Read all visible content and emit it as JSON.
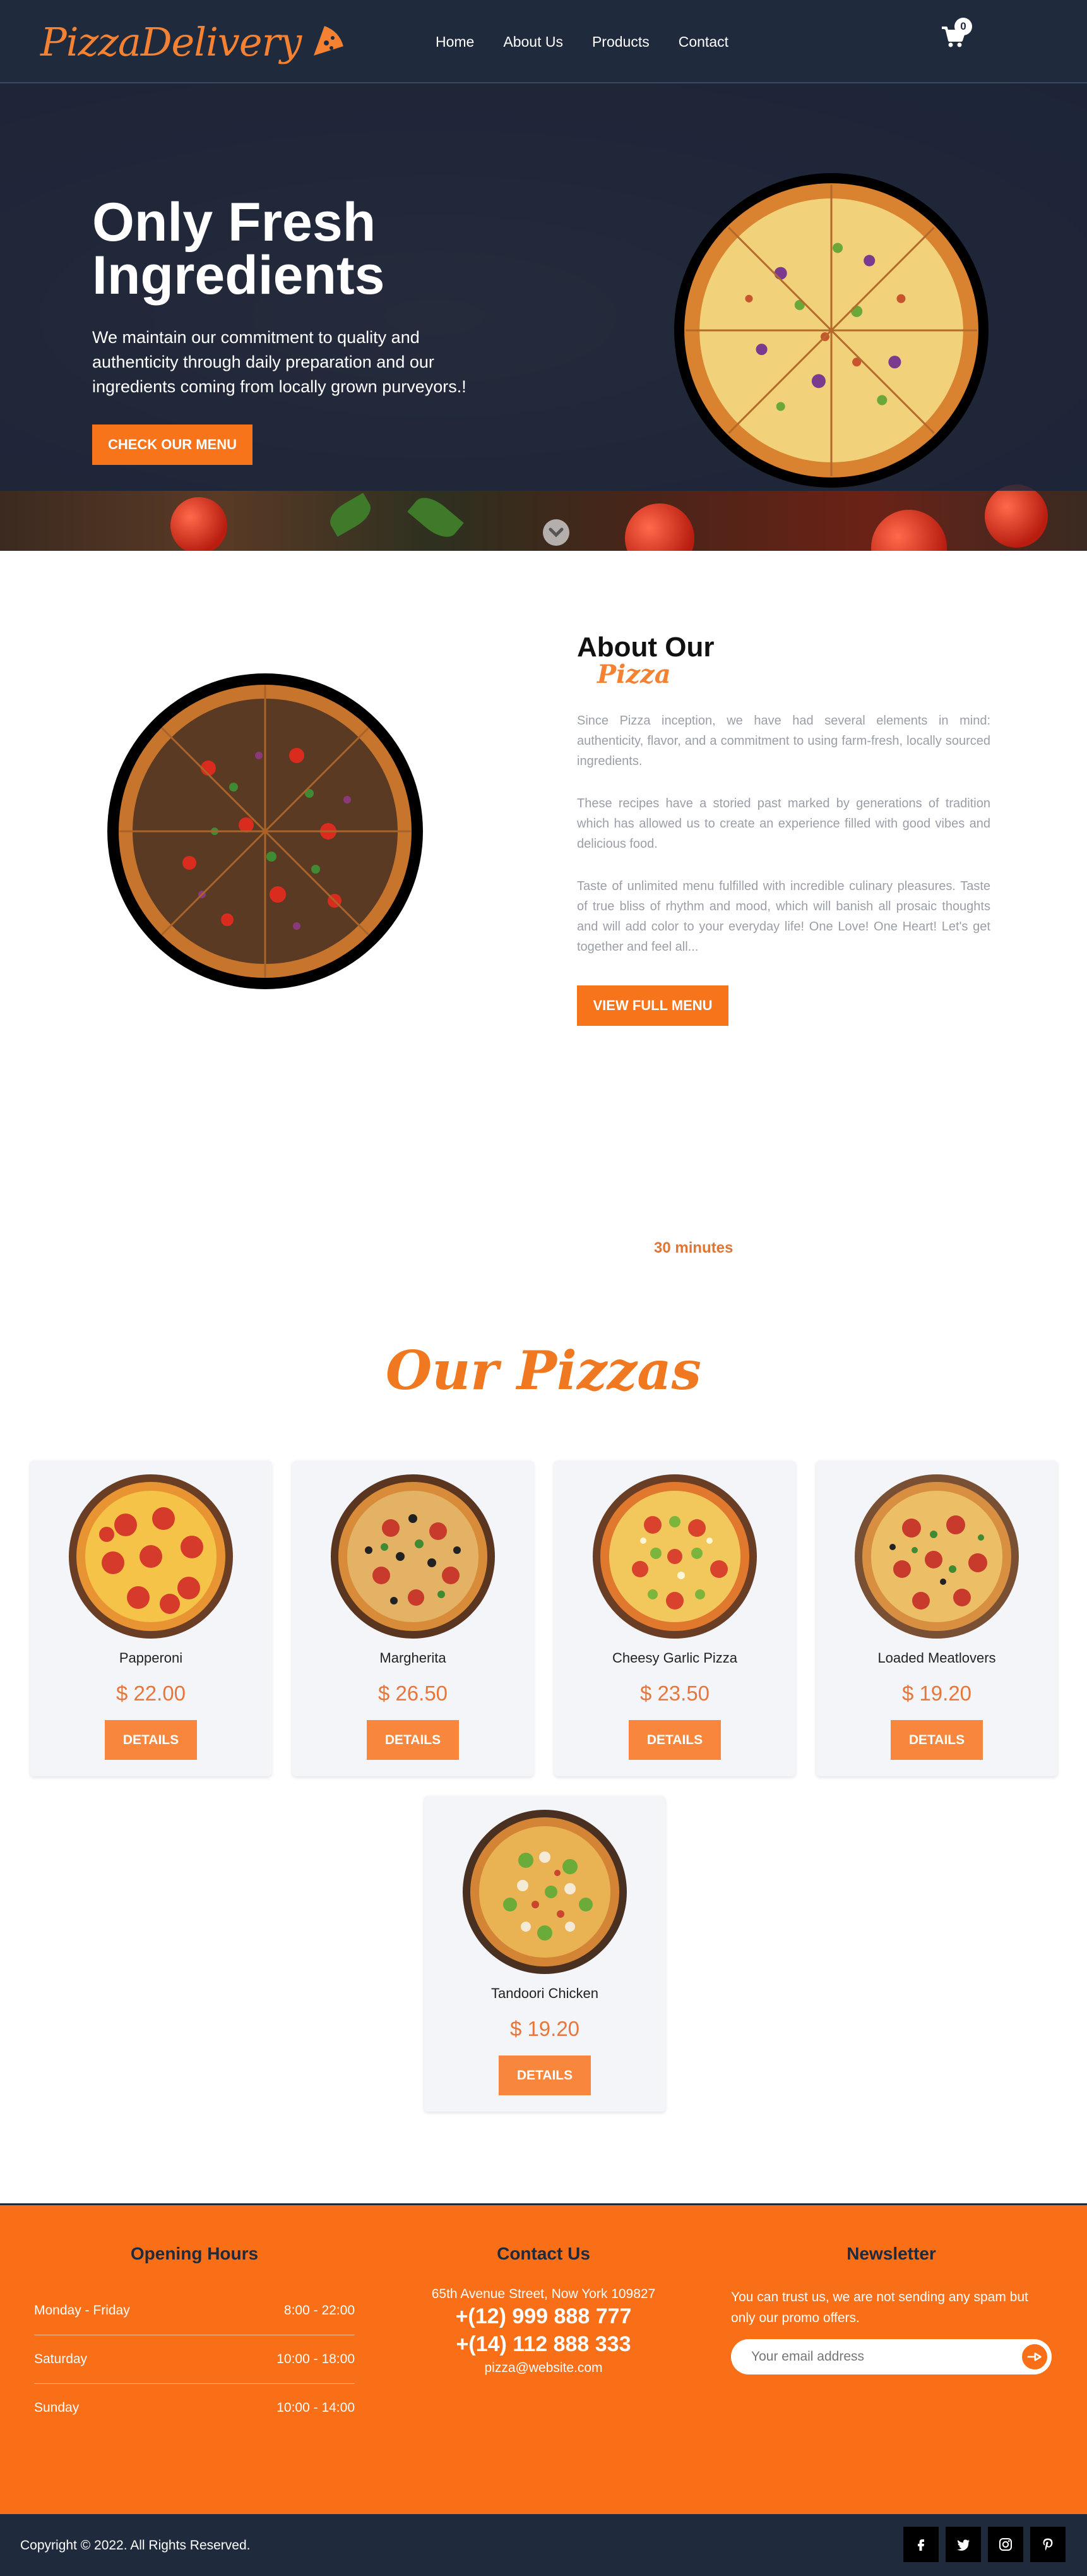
{
  "header": {
    "logo": "PizzaDelivery",
    "nav": [
      "Home",
      "About Us",
      "Products",
      "Contact"
    ],
    "cart_count": "0"
  },
  "hero": {
    "title_line1": "Only Fresh",
    "title_line2": "Ingredients",
    "text": "We maintain our commitment to quality and authenticity through daily preparation and our ingredients coming from locally grown purveyors.!",
    "button": "CHECK OUR MENU"
  },
  "about": {
    "title": "About Our",
    "subtitle": "Pizza",
    "p1": "Since Pizza inception, we have had several elements in mind: authenticity, flavor, and a commitment to using farm-fresh, locally sourced ingredients.",
    "p2": "These recipes have a storied past marked by generations of tradition which has allowed us to create an experience filled with good vibes and delicious food.",
    "p3": "Taste of unlimited menu fulfilled with incredible culinary pleasures. Taste of true bliss of rhythm and mood, which will banish all prosaic thoughts and will add color to your everyday life! One Love! One Heart! Let's get together and feel all...",
    "button": "VIEW FULL MENU",
    "minutes": "30 minutes"
  },
  "pizzas": {
    "title": "Our Pizzas",
    "details_label": "DETAILS",
    "items": [
      {
        "name": "Papperoni",
        "price": "$ 22.00"
      },
      {
        "name": "Margherita",
        "price": "$ 26.50"
      },
      {
        "name": "Cheesy Garlic Pizza",
        "price": "$ 23.50"
      },
      {
        "name": "Loaded Meatlovers",
        "price": "$ 19.20"
      },
      {
        "name": "Tandoori Chicken",
        "price": "$ 19.20"
      }
    ]
  },
  "footer": {
    "hours_title": "Opening Hours",
    "hours": [
      {
        "day": "Monday - Friday",
        "time": "8:00 - 22:00"
      },
      {
        "day": "Saturday",
        "time": "10:00 - 18:00"
      },
      {
        "day": "Sunday",
        "time": "10:00 - 14:00"
      }
    ],
    "contact_title": "Contact Us",
    "address": "65th Avenue Street, Now York 109827",
    "phone1": "+(12) 999 888 777",
    "phone2": "+(14) 112 888 333",
    "email": "pizza@website.com",
    "newsletter_title": "Newsletter",
    "newsletter_text": "You can trust us, we are not sending any spam but only our promo offers.",
    "email_placeholder": "Your email address",
    "copyright": "Copyright © 2022. All Rights Reserved.",
    "social": [
      "facebook-icon",
      "twitter-icon",
      "instagram-icon",
      "pinterest-icon"
    ]
  },
  "colors": {
    "accent": "#f8741a",
    "navy": "#1f2a3d",
    "footer_orange": "#f96f17"
  }
}
